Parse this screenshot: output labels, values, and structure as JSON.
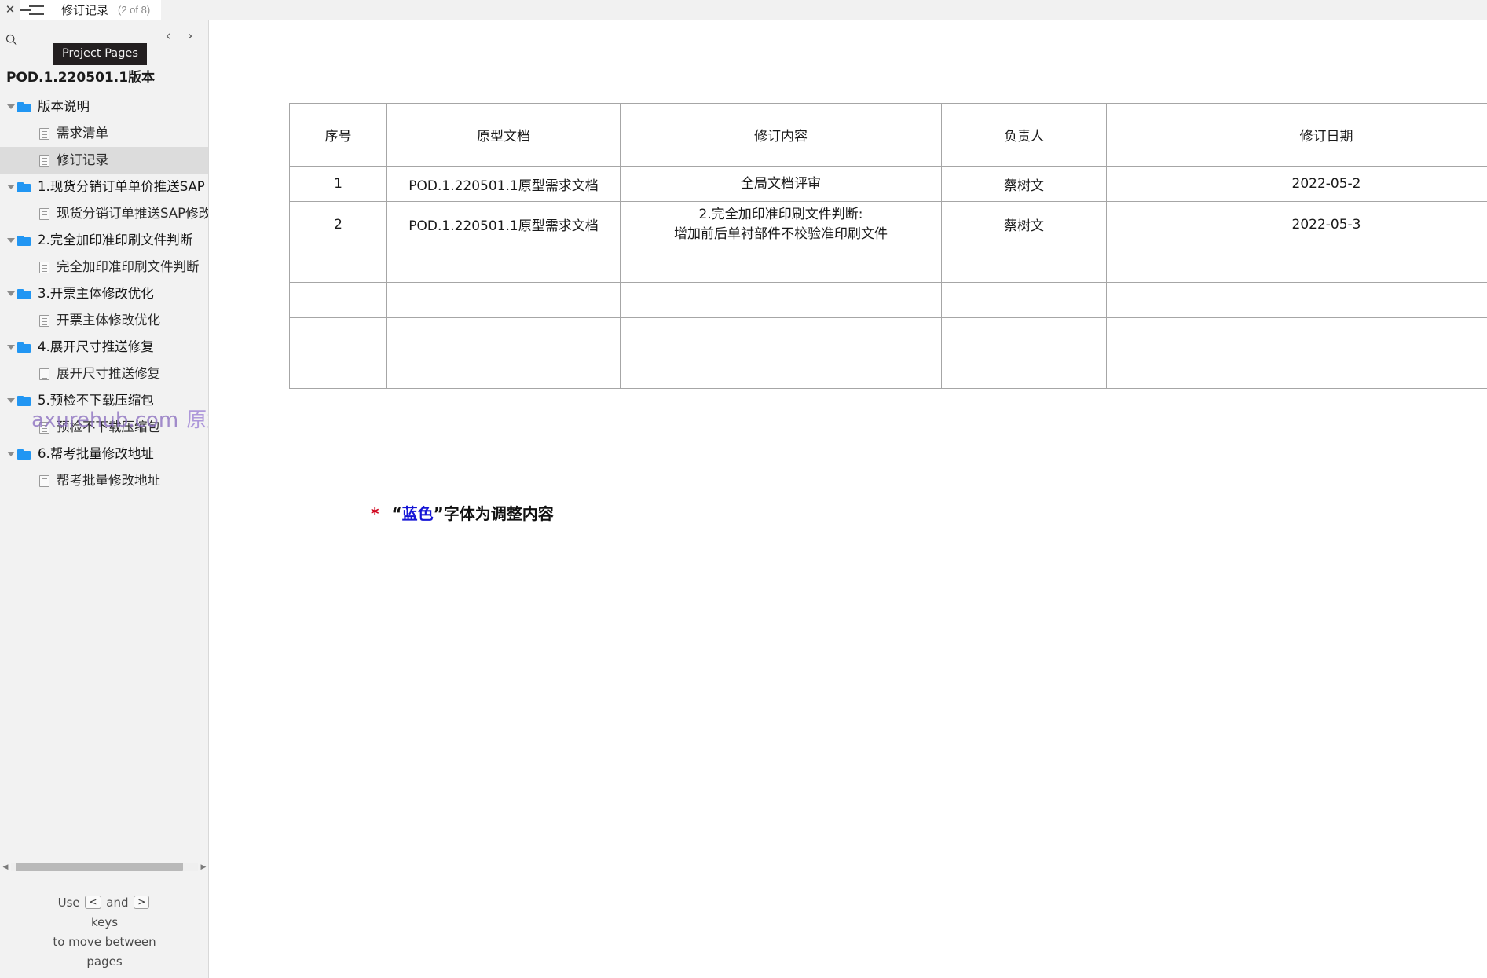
{
  "topbar": {
    "close_label": "✕",
    "menu_icon": "hamburger-icon",
    "title": "修订记录",
    "page_counter": "(2 of 8)"
  },
  "tooltip": {
    "text": "Project Pages"
  },
  "sidebar": {
    "search_icon": "search-icon",
    "prev_arrow": "‹",
    "next_arrow": "›",
    "project_title": "POD.1.220501.1版本",
    "tree": [
      {
        "type": "folder",
        "label": "版本说明",
        "expanded": true,
        "selected": false
      },
      {
        "type": "page",
        "label": "需求清单",
        "selected": false
      },
      {
        "type": "page",
        "label": "修订记录",
        "selected": true
      },
      {
        "type": "folder",
        "label": "1.现货分销订单单价推送SAP",
        "expanded": true,
        "selected": false
      },
      {
        "type": "page",
        "label": "现货分销订单推送SAP修改",
        "selected": false
      },
      {
        "type": "folder",
        "label": "2.完全加印准印刷文件判断",
        "expanded": true,
        "selected": false
      },
      {
        "type": "page",
        "label": "完全加印准印刷文件判断",
        "selected": false
      },
      {
        "type": "folder",
        "label": "3.开票主体修改优化",
        "expanded": true,
        "selected": false
      },
      {
        "type": "page",
        "label": "开票主体修改优化",
        "selected": false
      },
      {
        "type": "folder",
        "label": "4.展开尺寸推送修复",
        "expanded": true,
        "selected": false
      },
      {
        "type": "page",
        "label": "展开尺寸推送修复",
        "selected": false
      },
      {
        "type": "folder",
        "label": "5.预检不下载压缩包",
        "expanded": true,
        "selected": false
      },
      {
        "type": "page",
        "label": "预检不下载压缩包",
        "selected": false
      },
      {
        "type": "folder",
        "label": "6.帮考批量修改地址",
        "expanded": true,
        "selected": false
      },
      {
        "type": "page",
        "label": "帮考批量修改地址",
        "selected": false
      }
    ],
    "hint": {
      "use": "Use",
      "and": "and",
      "key_prev": "<",
      "key_next": ">",
      "keys": "keys",
      "line3": "to move between",
      "line4": "pages"
    },
    "scrollbar": {
      "left_arrow": "◀",
      "right_arrow": "▶"
    }
  },
  "content": {
    "table": {
      "headers": [
        "序号",
        "原型文档",
        "修订内容",
        "负责人",
        "修订日期"
      ],
      "rows": [
        {
          "seq": "1",
          "doc": "POD.1.220501.1原型需求文档",
          "content": "全局文档评审",
          "content_line2": "",
          "owner": "蔡树文",
          "date": "2022-05-2"
        },
        {
          "seq": "2",
          "doc": "POD.1.220501.1原型需求文档",
          "content": "2.完全加印准印刷文件判断:",
          "content_line2": "增加前后单衬部件不校验准印刷文件",
          "owner": "蔡树文",
          "date": "2022-05-3"
        },
        {
          "seq": "",
          "doc": "",
          "content": "",
          "content_line2": "",
          "owner": "",
          "date": ""
        },
        {
          "seq": "",
          "doc": "",
          "content": "",
          "content_line2": "",
          "owner": "",
          "date": ""
        },
        {
          "seq": "",
          "doc": "",
          "content": "",
          "content_line2": "",
          "owner": "",
          "date": ""
        },
        {
          "seq": "",
          "doc": "",
          "content": "",
          "content_line2": "",
          "owner": "",
          "date": ""
        }
      ]
    },
    "footnote": {
      "star": "*",
      "open_quote": "“",
      "blue_word": "蓝色",
      "close_quote": "”",
      "rest": "字体为调整内容"
    }
  },
  "watermark": {
    "domain": "axurehub.com",
    "cn": "原型资源站"
  },
  "colors": {
    "folder_blue": "#2196f3",
    "selection_gray": "#dcdcdc",
    "footnote_blue": "#1414d6",
    "footnote_red": "#d0021b",
    "watermark_purple": "#8b6fc0"
  }
}
